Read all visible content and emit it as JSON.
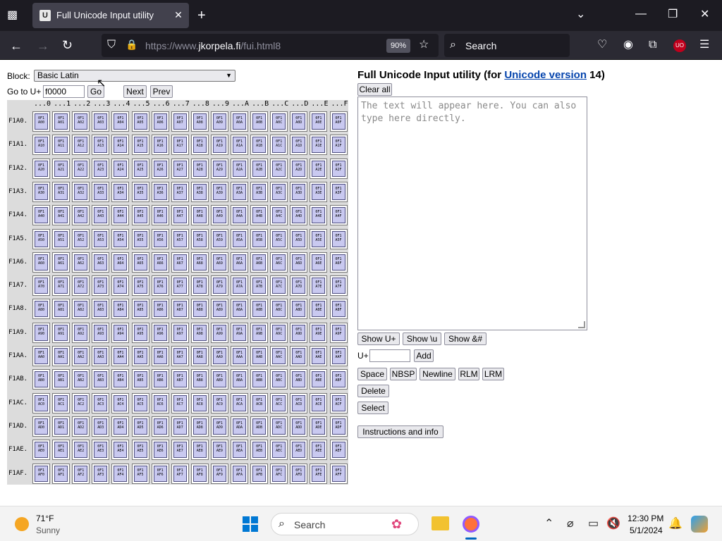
{
  "browser": {
    "tab_title": "Full Unicode Input utility",
    "tab_favicon": "U",
    "url_prefix": "https://www.",
    "url_domain": "jkorpela.fi",
    "url_path": "/fui.html8",
    "zoom": "90%",
    "search_placeholder": "Search"
  },
  "controls": {
    "block_label": "Block:",
    "block_value": "Basic Latin",
    "goto_label": "Go to U+",
    "goto_value": "f0000",
    "go_button": "Go",
    "next_button": "Next",
    "prev_button": "Prev"
  },
  "grid": {
    "columns": [
      "...0",
      "...1",
      "...2",
      "...3",
      "...4",
      "...5",
      "...6",
      "...7",
      "...8",
      "...9",
      "...A",
      "...B",
      "...C",
      "...D",
      "...E",
      "...F"
    ],
    "rows": [
      "F1A0.",
      "F1A1.",
      "F1A2.",
      "F1A3.",
      "F1A4.",
      "F1A5.",
      "F1A6.",
      "F1A7.",
      "F1A8.",
      "F1A9.",
      "F1AA.",
      "F1AB.",
      "F1AC.",
      "F1AD.",
      "F1AE.",
      "F1AF."
    ],
    "cell_prefix": "0F1"
  },
  "panel": {
    "title_prefix": "Full Unicode Input utility (for ",
    "title_link": "Unicode version",
    "title_suffix": " 14)",
    "clear_all": "Clear all",
    "textarea_placeholder": "The text will appear here. You can also type here directly.",
    "show_u": "Show U+",
    "show_backslash_u": "Show \\u",
    "show_amp": "Show &#",
    "uplus_label": "U+",
    "add_button": "Add",
    "space_button": "Space",
    "nbsp_button": "NBSP",
    "newline_button": "Newline",
    "rlm_button": "RLM",
    "lrm_button": "LRM",
    "delete_button": "Delete",
    "select_button": "Select",
    "instructions_button": "Instructions and info"
  },
  "taskbar": {
    "temperature": "71°F",
    "weather": "Sunny",
    "search_label": "Search",
    "time": "12:30 PM",
    "date": "5/1/2024"
  }
}
